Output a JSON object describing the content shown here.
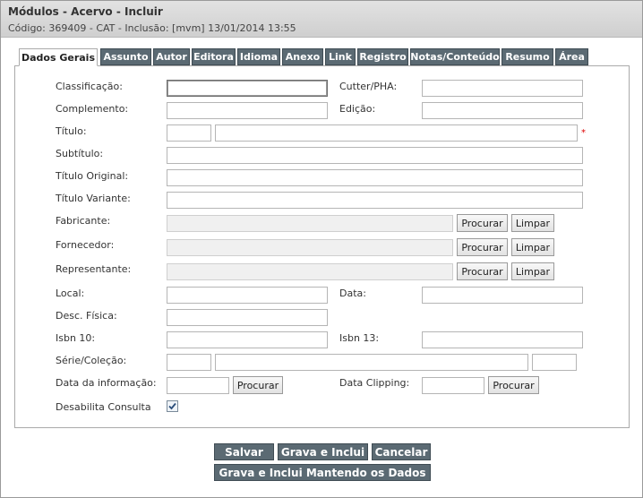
{
  "window": {
    "title": "Módulos - Acervo - Incluir",
    "subtitle": "Código: 369409 - CAT - Inclusão: [mvm] 13/01/2014 13:55"
  },
  "tabs": [
    {
      "label": "Dados Gerais",
      "active": true
    },
    {
      "label": "Assunto"
    },
    {
      "label": "Autor"
    },
    {
      "label": "Editora"
    },
    {
      "label": "Idioma"
    },
    {
      "label": "Anexo"
    },
    {
      "label": "Link"
    },
    {
      "label": "Registro"
    },
    {
      "label": "Notas/Conteúdo"
    },
    {
      "label": "Resumo"
    },
    {
      "label": "Área"
    }
  ],
  "form": {
    "classificacao": "Classificação:",
    "cutter": "Cutter/PHA:",
    "complemento": "Complemento:",
    "edicao": "Edição:",
    "titulo": "Título:",
    "required_mark": "*",
    "subtitulo": "Subtítulo:",
    "titulo_original": "Título Original:",
    "titulo_variante": "Título Variante:",
    "fabricante": "Fabricante:",
    "fornecedor": "Fornecedor:",
    "representante": "Representante:",
    "local": "Local:",
    "data": "Data:",
    "desc_fisica": "Desc. Física:",
    "isbn10": "Isbn 10:",
    "isbn13": "Isbn 13:",
    "serie": "Série/Coleção:",
    "data_informacao": "Data da informação:",
    "data_clipping": "Data Clipping:",
    "desabilita": "Desabilita Consulta",
    "desabilita_checked": true
  },
  "buttons": {
    "procurar": "Procurar",
    "limpar": "Limpar",
    "salvar": "Salvar",
    "grava_inclui": "Grava e Inclui",
    "cancelar": "Cancelar",
    "grava_mantendo": "Grava e Inclui Mantendo os Dados"
  },
  "icons": {
    "checkbox_check": "check-icon"
  }
}
